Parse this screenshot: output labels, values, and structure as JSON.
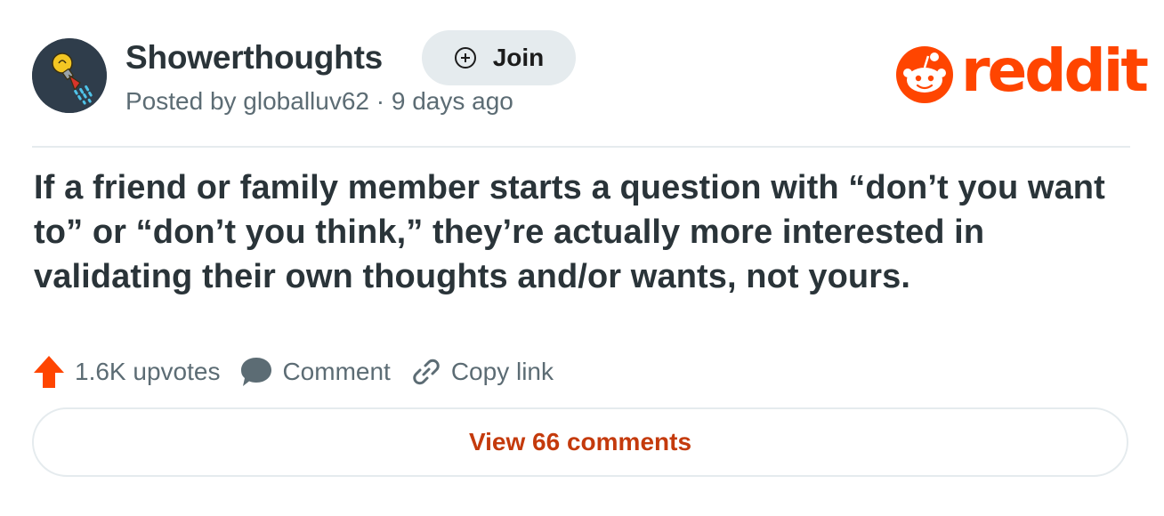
{
  "post": {
    "subreddit": "Showerthoughts",
    "join_label": "Join",
    "posted_line": "Posted by globalluv62 · 9 days ago",
    "title": "If a friend or family member starts a question with “don’t you want to” or “don’t you think,” they’re actually more interested in validating their own thoughts and/or wants, not yours."
  },
  "brand": {
    "wordmark": "reddit",
    "color": "#ff4500"
  },
  "actions": {
    "upvotes": "1.6K upvotes",
    "comment": "Comment",
    "copy_link": "Copy link"
  },
  "footer": {
    "view_comments": "View 66 comments"
  },
  "icons": {
    "avatar": "lightbulb-shower-icon",
    "join": "plus-circle-icon",
    "logo": "snoo-icon",
    "upvote": "upvote-arrow-icon",
    "comment": "speech-bubble-icon",
    "link": "chain-link-icon"
  },
  "colors": {
    "accent_text": "#c43a0c",
    "upvote": "#ff4500",
    "muted": "#5c6c74",
    "pill_bg": "#e5ebee"
  }
}
